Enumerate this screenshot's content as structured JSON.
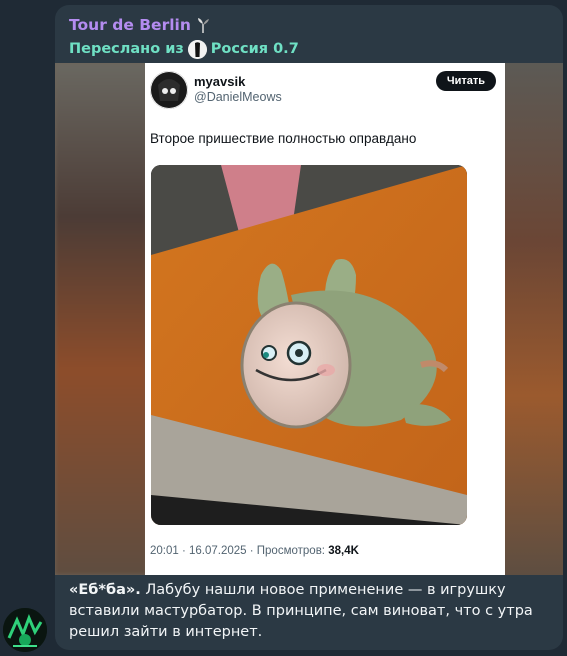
{
  "message": {
    "channel_name": "Tour de Berlin",
    "channel_emoji_icon": "rocket-plant-icon",
    "forwarded_prefix": "Переслано из",
    "forwarded_source": "Россия 0.7",
    "caption_bold": "«Еб*ба».",
    "caption_text": " Лабубу нашли новое применение — в игрушку вставили мастурбатор. В принципе, сам виноват, что с утра решил зайти в интернет."
  },
  "tweet": {
    "name": "myavsik",
    "handle": "@DanielMeows",
    "follow_label": "Читать",
    "text": "Второе пришествие полностью оправдано",
    "timestamp": "20:01 · 16.07.2025 · Просмотров: ",
    "views": "38,4K"
  },
  "colors": {
    "channel_name": "#b48cf0",
    "forwarded": "#6fe0c4",
    "bubble": "#2b3944",
    "background": "#1f2a35"
  }
}
